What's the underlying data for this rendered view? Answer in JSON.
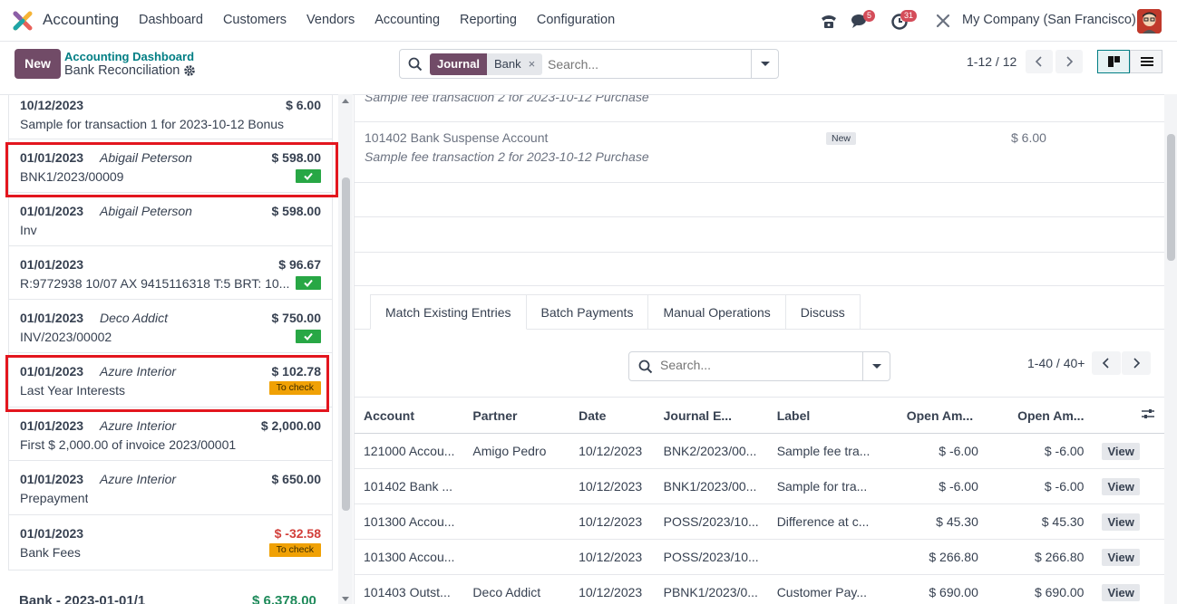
{
  "app": {
    "name": "Accounting"
  },
  "menu": [
    "Dashboard",
    "Customers",
    "Vendors",
    "Accounting",
    "Reporting",
    "Configuration"
  ],
  "systray": {
    "messages_count": "5",
    "activity_count": "31",
    "company": "My Company (San Francisco)"
  },
  "control": {
    "new_label": "New",
    "breadcrumb_parent": "Accounting Dashboard",
    "breadcrumb_current": "Bank Reconciliation",
    "facet_label": "Journal",
    "facet_value": "Bank",
    "facet_remove": "×",
    "search_placeholder": "Search...",
    "pager": "1-12 / 12"
  },
  "left": {
    "items": [
      {
        "date": "10/12/2023",
        "partner": "",
        "amount": "$ 6.00",
        "label": "Sample for transaction 1 for 2023-10-12 Bonus",
        "status": ""
      },
      {
        "date": "01/01/2023",
        "partner": "Abigail Peterson",
        "amount": "$ 598.00",
        "label": "BNK1/2023/00009",
        "status": "check"
      },
      {
        "date": "01/01/2023",
        "partner": "Abigail Peterson",
        "amount": "$ 598.00",
        "label": "Inv",
        "status": ""
      },
      {
        "date": "01/01/2023",
        "partner": "",
        "amount": "$ 96.67",
        "label": "R:9772938 10/07 AX 9415116318 T:5 BRT: 10...",
        "status": "check"
      },
      {
        "date": "01/01/2023",
        "partner": "Deco Addict",
        "amount": "$ 750.00",
        "label": "INV/2023/00002",
        "status": "check"
      },
      {
        "date": "01/01/2023",
        "partner": "Azure Interior",
        "amount": "$ 102.78",
        "label": "Last Year Interests",
        "status": "tocheck"
      },
      {
        "date": "01/01/2023",
        "partner": "Azure Interior",
        "amount": "$ 2,000.00",
        "label": "First $ 2,000.00 of invoice 2023/00001",
        "status": ""
      },
      {
        "date": "01/01/2023",
        "partner": "Azure Interior",
        "amount": "$ 650.00",
        "label": "Prepayment",
        "status": ""
      },
      {
        "date": "01/01/2023",
        "partner": "",
        "amount": "$ -32.58",
        "label": "Bank Fees",
        "status": "tocheck"
      }
    ],
    "to_check_label": "To check",
    "footer_title": "Bank - 2023-01-01/1",
    "footer_amount": "$ 6,378.00"
  },
  "right": {
    "top_partial_text": "Sample fee transaction 2 for 2023-10-12 Purchase",
    "line_account": "101402 Bank Suspense Account",
    "line_label": "Sample fee transaction 2 for 2023-10-12 Purchase",
    "line_badge": "New",
    "line_amount": "$ 6.00",
    "tabs": [
      "Match Existing Entries",
      "Batch Payments",
      "Manual Operations",
      "Discuss"
    ],
    "search_placeholder": "Search...",
    "pager": "1-40 / 40+",
    "columns": [
      "Account",
      "Partner",
      "Date",
      "Journal E...",
      "Label",
      "Open Am...",
      "Open Am..."
    ],
    "view_label": "View",
    "rows": [
      {
        "account": "121000 Accou...",
        "partner": "Amigo Pedro",
        "date": "10/12/2023",
        "journal": "BNK2/2023/00...",
        "label": "Sample fee tra...",
        "amt1": "$ -6.00",
        "amt2": "$ -6.00",
        "neg": true
      },
      {
        "account": "101402 Bank ...",
        "partner": "",
        "date": "10/12/2023",
        "journal": "BNK1/2023/00...",
        "label": "Sample for tra...",
        "amt1": "$ -6.00",
        "amt2": "$ -6.00",
        "neg": true
      },
      {
        "account": "101300 Accou...",
        "partner": "",
        "date": "10/12/2023",
        "journal": "POSS/2023/10...",
        "label": "Difference at c...",
        "amt1": "$ 45.30",
        "amt2": "$ 45.30",
        "neg": false
      },
      {
        "account": "101300 Accou...",
        "partner": "",
        "date": "10/12/2023",
        "journal": "POSS/2023/10...",
        "label": "",
        "amt1": "$ 266.80",
        "amt2": "$ 266.80",
        "neg": false
      },
      {
        "account": "101403 Outst...",
        "partner": "Deco Addict",
        "date": "10/12/2023",
        "journal": "PBNK1/2023/0...",
        "label": "Customer Pay...",
        "amt1": "$ 690.00",
        "amt2": "$ 690.00",
        "neg": false
      }
    ]
  },
  "colors": {
    "primary": "#714b67",
    "teal": "#017e84",
    "success": "#28a745",
    "warning": "#f0a105",
    "danger": "#d23f3a",
    "highlight": "#e3161e"
  }
}
